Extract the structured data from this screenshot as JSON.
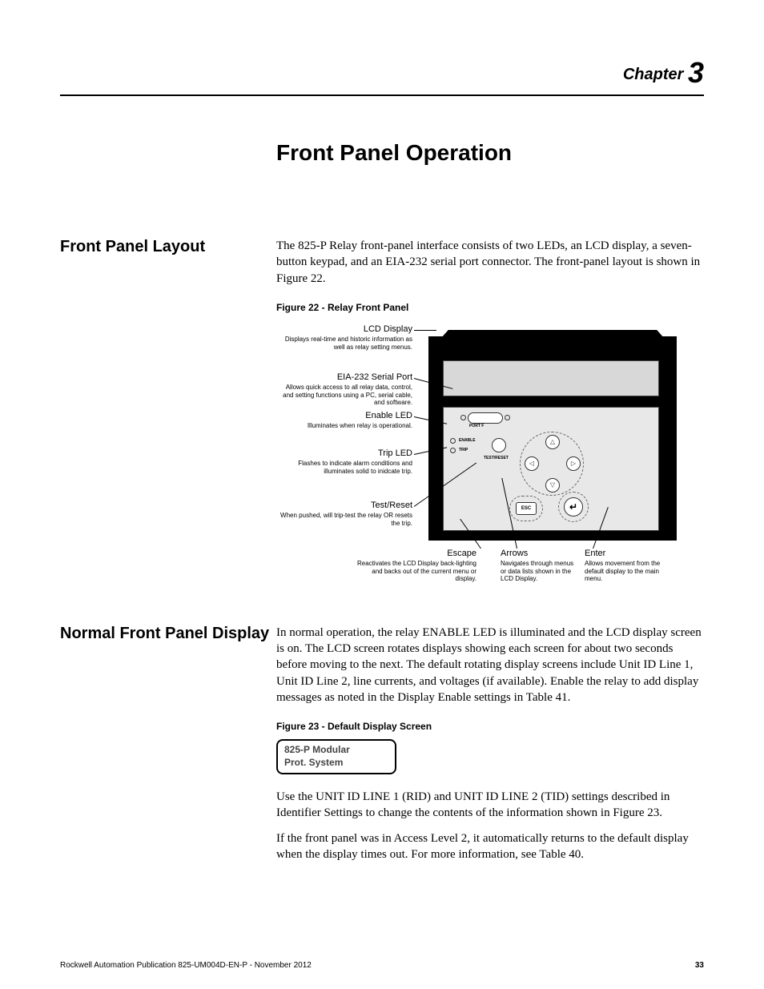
{
  "chapter": {
    "label": "Chapter",
    "number": "3"
  },
  "page_title": "Front Panel Operation",
  "section1": {
    "heading": "Front Panel Layout",
    "para1": "The 825-P Relay front-panel interface consists of two LEDs, an LCD display, a seven-button keypad, and an EIA-232 serial port connector. The front-panel layout is shown in Figure 22.",
    "fig_caption": "Figure 22 - Relay Front Panel"
  },
  "fig22": {
    "callouts_left": {
      "lcd": {
        "title": "LCD Display",
        "desc": "Displays real-time and historic information as well as relay setting menus."
      },
      "serial": {
        "title": "EIA-232 Serial Port",
        "desc": "Allows quick access to all relay data, control, and setting functions using a PC, serial cable, and software."
      },
      "enable": {
        "title": "Enable LED",
        "desc": "Illuminates when relay is operational."
      },
      "trip": {
        "title": "Trip LED",
        "desc": "Flashes to indicate alarm conditions and illuminates solid to inidcate trip."
      },
      "test": {
        "title": "Test/Reset",
        "desc": "When pushed, will trip-test the relay OR resets the trip."
      }
    },
    "callouts_bottom": {
      "escape": {
        "title": "Escape",
        "desc": "Reactivates the LCD Display back-lighting and backs out of the current menu or display."
      },
      "arrows": {
        "title": "Arrows",
        "desc": "Navigates through menus or data lists shown in the LCD Display."
      },
      "enter": {
        "title": "Enter",
        "desc": "Allows movement from the default display to the main menu."
      }
    },
    "keypad": {
      "port_label": "PORT F",
      "enable": "ENABLE",
      "trip": "TRIP",
      "test_reset": "TEST/RESET",
      "esc": "ESC",
      "enter_glyph": "↵",
      "up": "△",
      "down": "▽",
      "left": "◁",
      "right": "▷"
    }
  },
  "section2": {
    "heading": "Normal Front Panel Display",
    "para1": "In normal operation, the relay ENABLE LED is illuminated and the LCD display screen is on. The LCD screen rotates displays showing each screen for about two seconds before moving to the next. The default rotating display screens include Unit ID Line 1, Unit ID Line 2, line currents, and voltages (if available). Enable the relay to add display messages as noted in the Display Enable settings in Table 41.",
    "fig_caption": "Figure 23 - Default Display Screen",
    "lcd_line1": "825-P Modular",
    "lcd_line2": "Prot. System",
    "para2": "Use the UNIT ID LINE 1 (RID) and UNIT ID LINE 2 (TID) settings described in Identifier Settings to change the contents of the information shown in Figure 23.",
    "para3": "If the front panel was in Access Level 2, it automatically returns to the default display when the display times out. For more information, see Table 40."
  },
  "footer": {
    "pub": "Rockwell Automation Publication 825-UM004D-EN-P - November 2012",
    "page": "33"
  }
}
